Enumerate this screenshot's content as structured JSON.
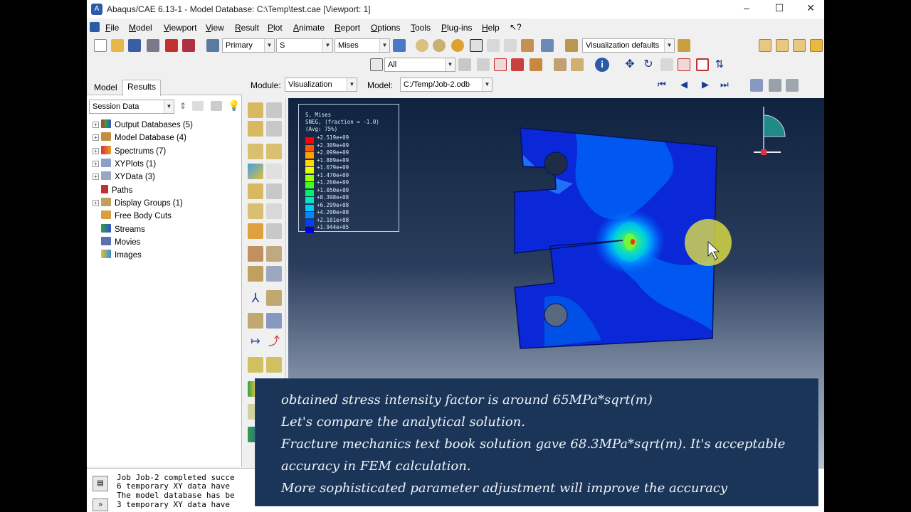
{
  "window": {
    "title": "Abaqus/CAE 6.13-1 - Model Database: C:\\Temp\\test.cae [Viewport: 1]"
  },
  "menu": [
    "File",
    "Model",
    "Viewport",
    "View",
    "Result",
    "Plot",
    "Animate",
    "Report",
    "Options",
    "Tools",
    "Plug-ins",
    "Help"
  ],
  "toolbar": {
    "step_combo": "Primary",
    "var_combo": "S",
    "field_combo": "Mises",
    "vis_defaults": "Visualization defaults",
    "select_combo": "All"
  },
  "context": {
    "module_label": "Module:",
    "module_value": "Visualization",
    "model_label": "Model:",
    "model_value": "C:/Temp/Job-2.odb"
  },
  "left_panel": {
    "tabs": [
      "Model",
      "Results"
    ],
    "session_combo": "Session Data",
    "tree": [
      "Output Databases (5)",
      "Model Database (4)",
      "Spectrums (7)",
      "XYPlots (1)",
      "XYData (3)",
      "Paths",
      "Display Groups (1)",
      "Free Body Cuts",
      "Streams",
      "Movies",
      "Images"
    ]
  },
  "legend": {
    "header": [
      "S, Mises",
      "SNEG, (fraction = -1.0)",
      "(Avg: 75%)"
    ],
    "values": [
      "+2.519e+09",
      "+2.309e+09",
      "+2.099e+09",
      "+1.889e+09",
      "+1.679e+09",
      "+1.470e+09",
      "+1.260e+09",
      "+1.050e+09",
      "+8.398e+08",
      "+6.299e+08",
      "+4.200e+08",
      "+2.101e+08",
      "+1.944e+05"
    ],
    "colors": [
      "#ff0000",
      "#ff5a00",
      "#ffa000",
      "#ffd800",
      "#e8ff00",
      "#a0ff00",
      "#40ff20",
      "#00f070",
      "#00e8c0",
      "#00c8ff",
      "#0088ff",
      "#0040ff",
      "#0000e0"
    ]
  },
  "messages": [
    "Job Job-2 completed succe",
    "6 temporary XY data have",
    "The model database has be",
    "3 temporary XY data have"
  ],
  "subtitle": [
    "obtained stress intensity factor is around 65MPa*sqrt(m)",
    "Let's compare the analytical solution.",
    "Fracture mechanics text book solution gave 68.3MPa*sqrt(m). It's acceptable",
    "accuracy in FEM calculation.",
    "More sophisticated parameter adjustment will improve the accuracy"
  ]
}
